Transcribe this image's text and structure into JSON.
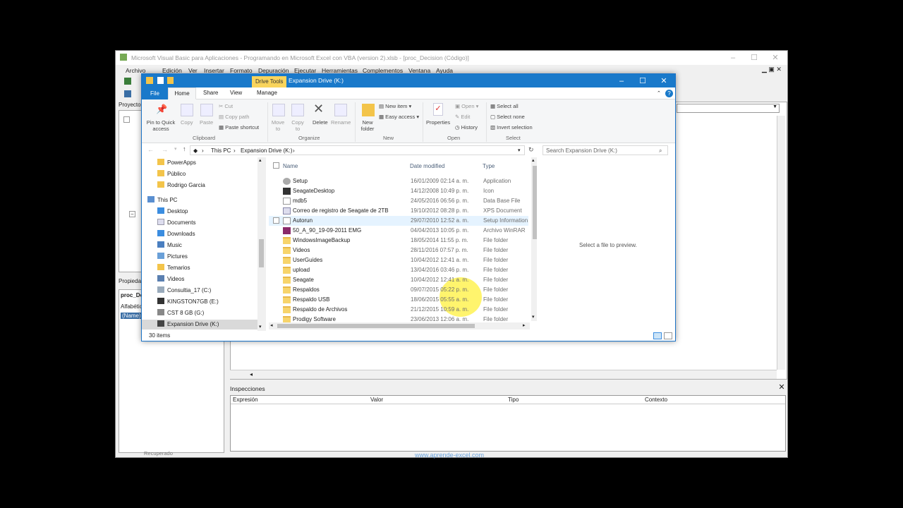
{
  "vba": {
    "title": "Microsoft Visual Basic para Aplicaciones - Programando en Microsoft Excel con VBA (version 2).xlsb - [proc_Decision (Código)]",
    "menu": [
      "Archivo",
      "Edición",
      "Ver",
      "Insertar",
      "Formato",
      "Depuración",
      "Ejecutar",
      "Herramientas",
      "Complementos",
      "Ventana",
      "Ayuda"
    ],
    "project_label": "Proyecto",
    "properties_label": "Propiedades",
    "props_object": "proc_De",
    "props_tab": "Alfabétic",
    "props_name": "(Name)",
    "inspections": {
      "title": "Inspecciones",
      "columns": [
        "Expresión",
        "Valor",
        "Tipo",
        "Contexto"
      ]
    },
    "status": "Recuperado",
    "watermark": "www.aprende-excel.com"
  },
  "explorer": {
    "context_tab": "Drive Tools",
    "title": "Expansion Drive (K:)",
    "tabs": {
      "file": "File",
      "home": "Home",
      "share": "Share",
      "view": "View",
      "manage": "Manage"
    },
    "ribbon": {
      "pin": "Pin to Quick access",
      "copy": "Copy",
      "paste": "Paste",
      "cut": "Cut",
      "copy_path": "Copy path",
      "paste_shortcut": "Paste shortcut",
      "clipboard": "Clipboard",
      "move_to": "Move to",
      "copy_to": "Copy to",
      "delete": "Delete",
      "rename": "Rename",
      "organize": "Organize",
      "new_folder": "New folder",
      "new_item": "New item",
      "easy_access": "Easy access",
      "new": "New",
      "properties": "Properties",
      "open": "Open",
      "edit": "Edit",
      "history": "History",
      "open_group": "Open",
      "select_all": "Select all",
      "select_none": "Select none",
      "invert_selection": "Invert selection",
      "select": "Select"
    },
    "address": {
      "this_pc": "This PC",
      "drive": "Expansion Drive (K:)"
    },
    "search_placeholder": "Search Expansion Drive (K:)",
    "nav": [
      "PowerApps",
      "Público",
      "Rodrigo Garcia",
      "This PC",
      "Desktop",
      "Documents",
      "Downloads",
      "Music",
      "Pictures",
      "Temarios",
      "Videos",
      "Consultia_17 (C:)",
      "KINGSTON7GB (E:)",
      "CST 8 GB (G:)",
      "Expansion Drive (K:)"
    ],
    "columns": {
      "name": "Name",
      "date": "Date modified",
      "type": "Type"
    },
    "files": [
      {
        "name": "Setup",
        "date": "16/01/2009 02:14 a. m.",
        "type": "Application"
      },
      {
        "name": "SeagateDesktop",
        "date": "14/12/2008 10:49 p. m.",
        "type": "Icon"
      },
      {
        "name": "mdb5",
        "date": "24/05/2016 06:56 p. m.",
        "type": "Data Base File"
      },
      {
        "name": "Correo de registro de Seagate de 2TB",
        "date": "19/10/2012 08:28 p. m.",
        "type": "XPS Document"
      },
      {
        "name": "Autorun",
        "date": "29/07/2010 12:52 a. m.",
        "type": "Setup Information"
      },
      {
        "name": "50_A_90_19-09-2011 EMG",
        "date": "04/04/2013 10:05 p. m.",
        "type": "Archivo WinRAR"
      },
      {
        "name": "WindowsImageBackup",
        "date": "18/05/2014 11:55 p. m.",
        "type": "File folder"
      },
      {
        "name": "Videos",
        "date": "28/11/2016 07:57 p. m.",
        "type": "File folder"
      },
      {
        "name": "UserGuides",
        "date": "10/04/2012 12:41 a. m.",
        "type": "File folder"
      },
      {
        "name": "upload",
        "date": "13/04/2016 03:46 p. m.",
        "type": "File folder"
      },
      {
        "name": "Seagate",
        "date": "10/04/2012 12:41 a. m.",
        "type": "File folder"
      },
      {
        "name": "Respaldos",
        "date": "09/07/2015 05:22 p. m.",
        "type": "File folder"
      },
      {
        "name": "Respaldo USB",
        "date": "18/06/2015 05:55 a. m.",
        "type": "File folder"
      },
      {
        "name": "Respaldo de Archivos",
        "date": "21/12/2015 10:59 a. m.",
        "type": "File folder"
      },
      {
        "name": "Prodigy Software",
        "date": "23/06/2013 12:06 a. m.",
        "type": "File folder"
      }
    ],
    "preview_text": "Select a file to preview.",
    "status": "30 items"
  }
}
